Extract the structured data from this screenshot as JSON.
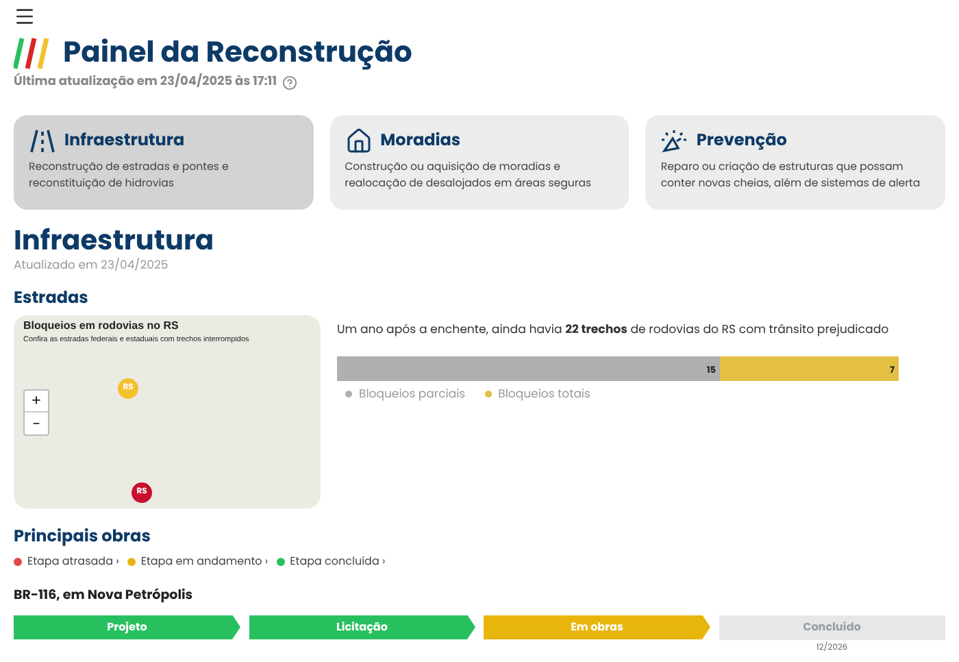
{
  "header": {
    "title": "Painel da Reconstrução",
    "updated": "Última atualização em 23/04/2025 às 17:11"
  },
  "categories": [
    {
      "kind": "road",
      "title": "Infraestrutura",
      "description": "Reconstrução de estradas e pontes e reconstituição de hidrovias",
      "selected": true
    },
    {
      "kind": "house",
      "title": "Moradias",
      "description": "Construção ou aquisição de moradias e realocação de desalojados em áreas seguras",
      "selected": false
    },
    {
      "kind": "alert",
      "title": "Prevenção",
      "description": "Reparo ou criação de estruturas que possam conter novas cheias, além de sistemas de alerta",
      "selected": false
    }
  ],
  "section": {
    "title": "Infraestrutura",
    "updated": "Atualizado em 23/04/2025"
  },
  "roads": {
    "title": "Estradas",
    "map": {
      "title": "Bloqueios em rodovias no RS",
      "subtitle": "Confira as estradas federais e estaduais com trechos interrompidos",
      "zoom_in": "+",
      "zoom_out": "−",
      "markers": [
        {
          "label": "RS",
          "color": "#f2c12e"
        },
        {
          "label": "RS",
          "color": "#c8102e"
        }
      ]
    },
    "summary": "Um ano após a enchente, ainda havia **22 trechos** de rodovias do RS com trânsito prejudicado",
    "chart_data": {
      "type": "bar",
      "orientation": "horizontal",
      "stacked": true,
      "legend": true,
      "data_labels": true,
      "series": [
        {
          "name": "Bloqueios parciais",
          "color": "#b0b0b0",
          "values": [
            15
          ]
        },
        {
          "name": "Bloqueios totais",
          "color": "#e3c042",
          "values": [
            7
          ]
        }
      ]
    }
  },
  "works": {
    "title": "Principais obras",
    "legend": [
      {
        "label": "Etapa atrasada ›",
        "color": "#e04848"
      },
      {
        "label": "Etapa em andamento ›",
        "color": "#e8b50c"
      },
      {
        "label": "Etapa concluída ›",
        "color": "#28c05f"
      }
    ],
    "project": {
      "name": "BR-116, em Nova Petrópolis",
      "steps": [
        {
          "label": "Projeto",
          "kind": "done"
        },
        {
          "label": "Licitação",
          "kind": "done"
        },
        {
          "label": "Em obras",
          "kind": "progress"
        },
        {
          "label": "Concluído",
          "kind": "pending",
          "date": "12/2026"
        }
      ]
    }
  }
}
